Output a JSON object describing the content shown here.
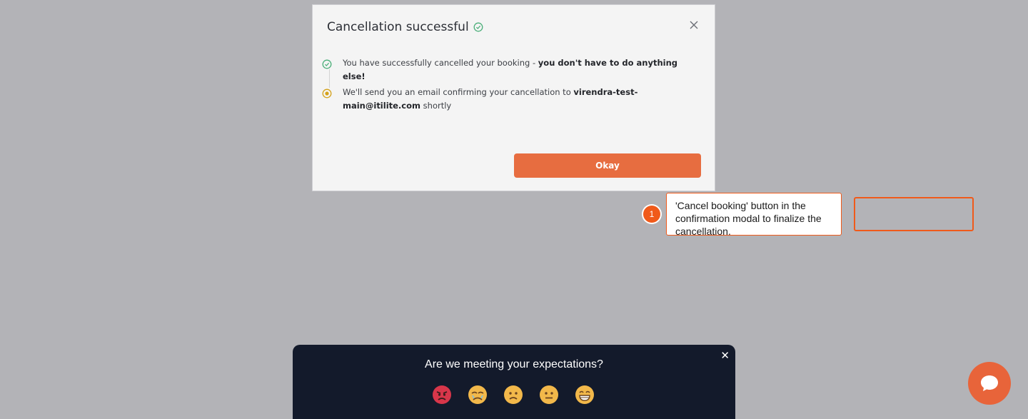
{
  "modal": {
    "title": "Cancellation successful",
    "close_icon": "close-icon",
    "steps": [
      {
        "icon": "check-circle-icon",
        "text_prefix": "You have successfully cancelled your booking - ",
        "text_bold": "you don't have to do anything else!",
        "text_suffix": ""
      },
      {
        "icon": "pending-circle-icon",
        "text_prefix": "We'll send you an email confirming your cancellation to ",
        "text_bold": "virendra-test-main@itilite.com",
        "text_suffix": " shortly"
      }
    ],
    "okay_label": "Okay"
  },
  "annotation": {
    "number": "1",
    "text": "'Cancel booking' button in the confirmation modal to finalize the cancellation."
  },
  "feedback": {
    "title": "Are we meeting your expectations?",
    "close_label": "✕",
    "emojis": [
      "angry-emoji-icon",
      "sad-emoji-icon",
      "frown-emoji-icon",
      "neutral-emoji-icon",
      "grin-emoji-icon"
    ]
  },
  "chat": {
    "icon": "chat-bubble-icon"
  },
  "colors": {
    "accent": "#e76d40",
    "annotation": "#f05a1a",
    "success": "#4caf7a",
    "pending": "#d4a21c",
    "feedback_bg": "#131a2b"
  }
}
